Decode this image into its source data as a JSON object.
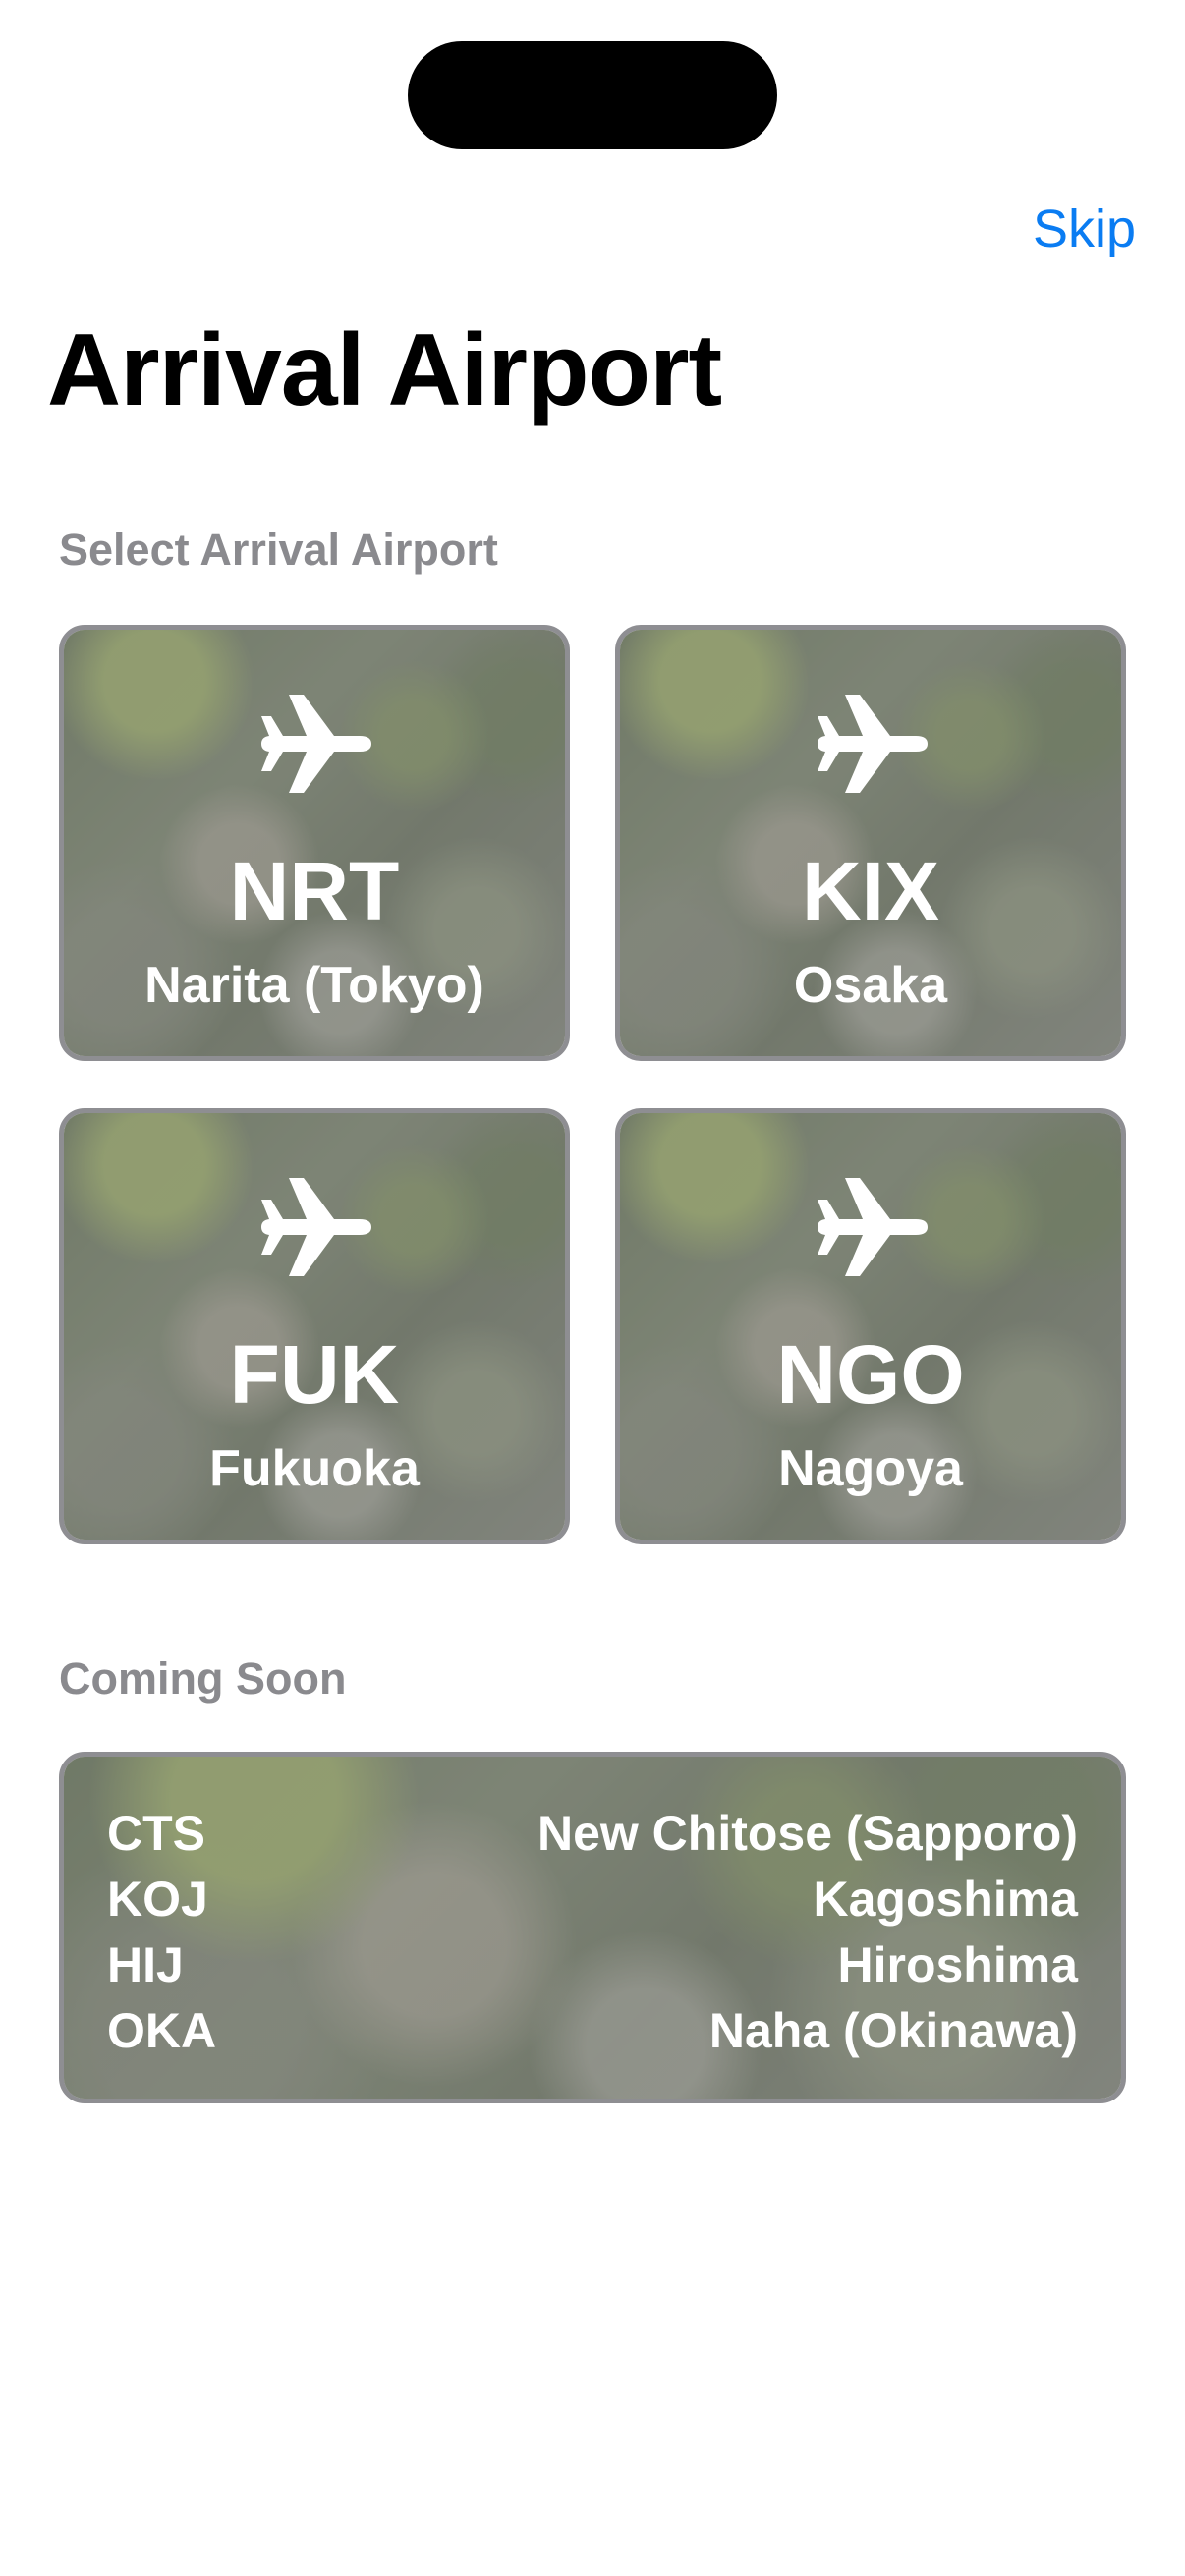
{
  "header": {
    "skip_label": "Skip",
    "title": "Arrival Airport"
  },
  "select_section": {
    "label": "Select Arrival Airport",
    "airports": [
      {
        "code": "NRT",
        "city": "Narita (Tokyo)",
        "icon": "airplane-icon"
      },
      {
        "code": "KIX",
        "city": "Osaka",
        "icon": "airplane-icon"
      },
      {
        "code": "FUK",
        "city": "Fukuoka",
        "icon": "airplane-icon"
      },
      {
        "code": "NGO",
        "city": "Nagoya",
        "icon": "airplane-icon"
      }
    ]
  },
  "coming_soon": {
    "label": "Coming Soon",
    "airports": [
      {
        "code": "CTS",
        "city": "New Chitose (Sapporo)"
      },
      {
        "code": "KOJ",
        "city": "Kagoshima"
      },
      {
        "code": "HIJ",
        "city": "Hiroshima"
      },
      {
        "code": "OKA",
        "city": "Naha (Okinawa)"
      }
    ]
  },
  "colors": {
    "accent": "#0a7cf2",
    "section_label": "#8a8a8e",
    "tile_border": "#8e8e92"
  }
}
